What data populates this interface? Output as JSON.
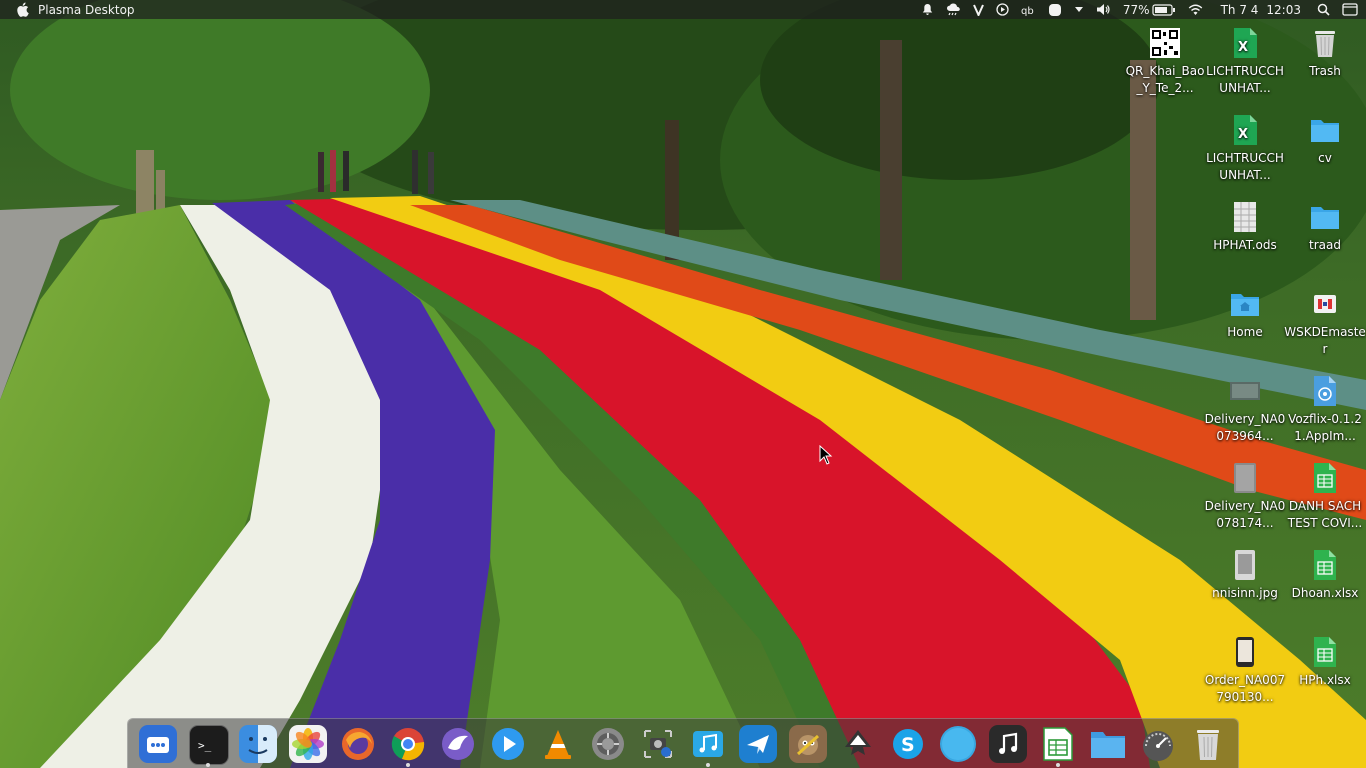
{
  "menubar": {
    "app_title": "Plasma Desktop",
    "battery_percent": "77%",
    "date": "Th 7 4",
    "time": "12:03",
    "tray_icons": [
      "notification-bell-icon",
      "weather-icon",
      "vpn-icon",
      "media-player-icon",
      "keyboard-layout-icon",
      "toggle-icon",
      "chevron-down-icon",
      "volume-icon",
      "battery-icon",
      "wifi-icon",
      "search-icon",
      "display-icon"
    ]
  },
  "desktop_icons": [
    {
      "label": "QR_Khai_Bao_Y_Te_2...",
      "icon": "qr-image-icon"
    },
    {
      "label": "LICHTRUCCHUNHAT...",
      "icon": "excel-file-icon"
    },
    {
      "label": "Trash",
      "icon": "trash-icon"
    },
    {
      "label": "LICHTRUCCHUNHAT...",
      "icon": "excel-file-icon"
    },
    {
      "label": "cv",
      "icon": "folder-icon"
    },
    {
      "label": "HPHAT.ods",
      "icon": "spreadsheet-icon"
    },
    {
      "label": "traad",
      "icon": "folder-icon"
    },
    {
      "label": "Home",
      "icon": "home-folder-icon"
    },
    {
      "label": "WSKDEmaster",
      "icon": "app-icon"
    },
    {
      "label": "Delivery_NA0073964...",
      "icon": "image-file-icon"
    },
    {
      "label": "Vozflix-0.1.21.AppIm...",
      "icon": "appimage-icon"
    },
    {
      "label": "Delivery_NA0078174...",
      "icon": "image-file-icon"
    },
    {
      "label": "DANH SACH TEST COVI...",
      "icon": "sheet-file-icon"
    },
    {
      "label": "nnisinn.jpg",
      "icon": "image-file-icon"
    },
    {
      "label": "Dhoan.xlsx",
      "icon": "sheet-file-icon"
    },
    {
      "label": "Order_NA007790130...",
      "icon": "image-file-icon"
    },
    {
      "label": "HPh.xlsx",
      "icon": "sheet-file-icon"
    }
  ],
  "dock": {
    "apps": [
      {
        "name": "launcher-icon",
        "color": "#2f6fd6"
      },
      {
        "name": "terminal-icon",
        "color": "#1c1c1c"
      },
      {
        "name": "finder-icon",
        "color": "#3b8de0"
      },
      {
        "name": "photos-icon",
        "color": "#f2f2f2"
      },
      {
        "name": "firefox-icon",
        "color": "#e8672a"
      },
      {
        "name": "chrome-icon",
        "color": "#ffffff"
      },
      {
        "name": "eagle-icon",
        "color": "#7a5cc8"
      },
      {
        "name": "video-player-icon",
        "color": "#2e9af0"
      },
      {
        "name": "vlc-icon",
        "color": "#f08a00"
      },
      {
        "name": "system-settings-icon",
        "color": "#8a8a8a"
      },
      {
        "name": "screenshot-icon",
        "color": "#444444"
      },
      {
        "name": "music-store-icon",
        "color": "#2aa8e6"
      },
      {
        "name": "airplane-app-icon",
        "color": "#1e7fd0"
      },
      {
        "name": "gimp-icon",
        "color": "#8a6a4a"
      },
      {
        "name": "inkscape-icon",
        "color": "#333333"
      },
      {
        "name": "skype-icon",
        "color": "#1aa3e8"
      },
      {
        "name": "browser-orb-icon",
        "color": "#39a7e0"
      },
      {
        "name": "music-icon",
        "color": "#2a2a2a"
      },
      {
        "name": "spreadsheet-app-icon",
        "color": "#2e9b3a"
      },
      {
        "name": "files-icon",
        "color": "#3f9be0"
      },
      {
        "name": "speedometer-icon",
        "color": "#555555"
      },
      {
        "name": "trash-dock-icon",
        "color": "#d8d8d8"
      }
    ]
  }
}
